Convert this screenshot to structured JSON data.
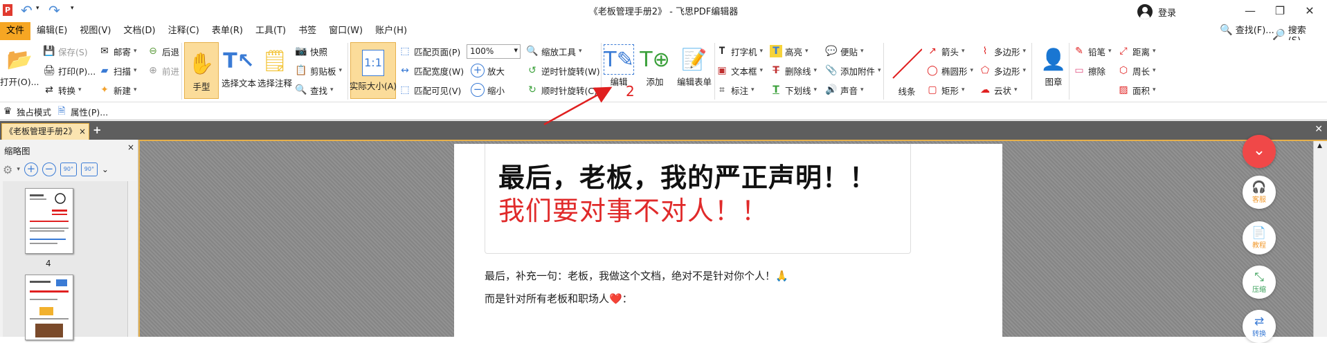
{
  "window": {
    "title": "《老板管理手册2》 - 飞思PDF编辑器",
    "app_logo": "P",
    "login_label": "登录",
    "minimize": "—",
    "restore": "❐",
    "close": "✕"
  },
  "quick_access": {
    "undo": "↶",
    "redo": "↷",
    "more": "▾"
  },
  "menus": [
    "文件",
    "编辑(E)",
    "视图(V)",
    "文档(D)",
    "注释(C)",
    "表单(R)",
    "工具(T)",
    "书签",
    "窗口(W)",
    "账户(H)"
  ],
  "menu_right": {
    "find": "查找(F)...",
    "search": "搜索(S)..."
  },
  "ribbon": {
    "open": "打开(O)...",
    "save": "保存(S)",
    "print": "打印(P)...",
    "convert": "转换",
    "mail": "邮寄",
    "scan": "扫描",
    "new": "新建",
    "back": "后退",
    "forward": "前进",
    "hand": "手型",
    "select_text": "选择文本",
    "select_anno": "选择注释",
    "snapshot": "快照",
    "clipboard": "剪贴板",
    "find": "查找",
    "actual_size": "实际大小(A)",
    "actual_size_icon": "1:1",
    "fit_page": "匹配页面(P)",
    "fit_width": "匹配宽度(W)",
    "fit_visible": "匹配可见(V)",
    "zoom_value": "100%",
    "zoom_tool": "缩放工具",
    "zoom_in": "放大",
    "zoom_out": "缩小",
    "rotate_ccw": "逆时针旋转(W)",
    "rotate_cw": "顺时针旋转(C)",
    "edit": "编辑",
    "add": "添加",
    "edit_form": "编辑表单",
    "typewriter": "打字机",
    "textbox": "文本框",
    "callout": "标注",
    "highlight": "高亮",
    "strikeout": "删除线",
    "underline": "下划线",
    "sticky": "便贴",
    "attach": "添加附件",
    "sound": "声音",
    "line": "线条",
    "arrow": "箭头",
    "ellipse": "椭圆形",
    "rect": "矩形",
    "polygon": "多边形",
    "polyline": "多边形",
    "cloud": "云状",
    "stamp": "图章",
    "pencil": "铅笔",
    "eraser": "擦除",
    "distance": "距离",
    "perimeter": "周长",
    "area": "面积"
  },
  "subrow": {
    "exclusive": "独占模式",
    "properties": "属性(P)..."
  },
  "tabs": {
    "doc_tab": "《老板管理手册2》",
    "close": "×",
    "plus": "+",
    "strip_close": "✕"
  },
  "sidebar": {
    "title": "缩略图",
    "close": "×",
    "page_label": "4",
    "rot_ccw": "90°",
    "rot_cw": "90°"
  },
  "document": {
    "quote_line1": "最后，老板，我的严正声明！！",
    "quote_line2": "我们要对事不对人！！",
    "para1": "最后，补充一句：老板，我做这个文档，绝对不是针对你个人！🙏",
    "para2": "而是针对所有老板和职场人❤️："
  },
  "floating": {
    "service": "客服",
    "tutorial": "教程",
    "compress": "压缩",
    "convert": "转换"
  },
  "annotation": {
    "number": "2"
  },
  "colors": {
    "accent": "#f6a623",
    "arrow": "#e02020",
    "fab_red": "#f04848",
    "quote_red": "#e02a2a"
  }
}
